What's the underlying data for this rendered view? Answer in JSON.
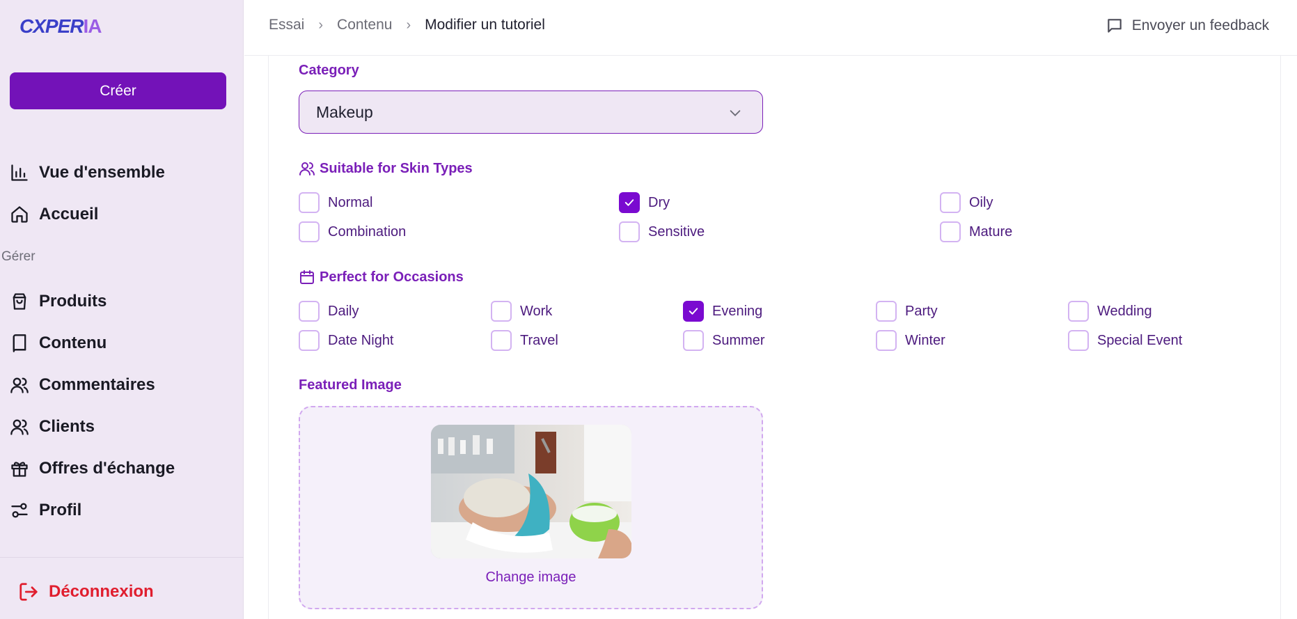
{
  "brand": {
    "logo_part1": "CXPER",
    "logo_part2": "IA"
  },
  "sidebar": {
    "create_label": "Créer",
    "top_items": [
      {
        "label": "Vue d'ensemble",
        "icon": "bar-chart-icon"
      },
      {
        "label": "Accueil",
        "icon": "home-icon"
      }
    ],
    "section_label": "Gérer",
    "manage_items": [
      {
        "label": "Produits",
        "icon": "shopping-bag-icon"
      },
      {
        "label": "Contenu",
        "icon": "book-icon"
      },
      {
        "label": "Commentaires",
        "icon": "users-icon"
      },
      {
        "label": "Clients",
        "icon": "users-icon"
      },
      {
        "label": "Offres d'échange",
        "icon": "gift-icon"
      },
      {
        "label": "Profil",
        "icon": "sliders-icon"
      }
    ],
    "logout_label": "Déconnexion"
  },
  "header": {
    "breadcrumb": [
      "Essai",
      "Contenu",
      "Modifier un tutoriel"
    ],
    "feedback_label": "Envoyer un feedback"
  },
  "form": {
    "category": {
      "label": "Category",
      "value": "Makeup"
    },
    "skin_types": {
      "label": "Suitable for Skin Types",
      "options": [
        {
          "label": "Normal",
          "checked": false
        },
        {
          "label": "Dry",
          "checked": true
        },
        {
          "label": "Oily",
          "checked": false
        },
        {
          "label": "Combination",
          "checked": false
        },
        {
          "label": "Sensitive",
          "checked": false
        },
        {
          "label": "Mature",
          "checked": false
        }
      ]
    },
    "occasions": {
      "label": "Perfect for Occasions",
      "options": [
        {
          "label": "Daily",
          "checked": false
        },
        {
          "label": "Work",
          "checked": false
        },
        {
          "label": "Evening",
          "checked": true
        },
        {
          "label": "Party",
          "checked": false
        },
        {
          "label": "Wedding",
          "checked": false
        },
        {
          "label": "Date Night",
          "checked": false
        },
        {
          "label": "Travel",
          "checked": false
        },
        {
          "label": "Summer",
          "checked": false
        },
        {
          "label": "Winter",
          "checked": false
        },
        {
          "label": "Special Event",
          "checked": false
        }
      ]
    },
    "featured_image": {
      "label": "Featured Image",
      "change_label": "Change image"
    }
  },
  "colors": {
    "accent": "#7312b8",
    "sidebar_bg": "#efe7f4",
    "danger": "#e01e2e"
  }
}
